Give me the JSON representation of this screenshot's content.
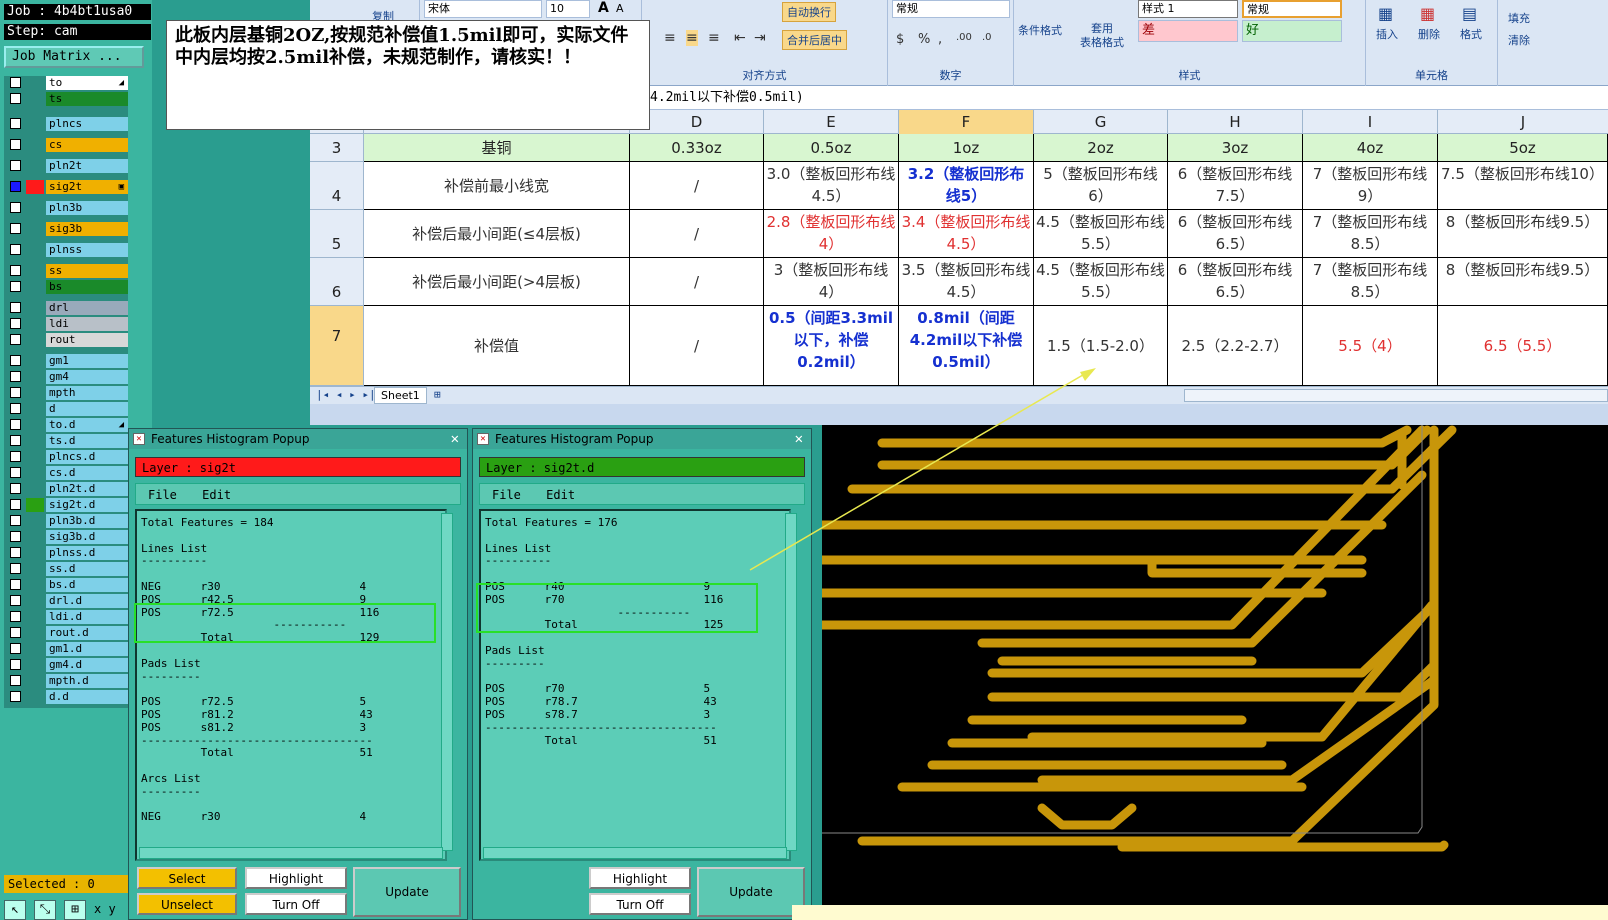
{
  "genesis": {
    "job_label": "Job : 4b4bt1usa0",
    "step_label": "Step: cam",
    "matrix_button": "Job Matrix ...",
    "selected_label": "Selected : 0",
    "layers": [
      {
        "name": "to",
        "color": "#ffffff",
        "mark": "◢"
      },
      {
        "name": "ts",
        "color": "#1a8a2a",
        "mark": ""
      },
      {
        "name": "plncs",
        "color": "#7ed0e8",
        "mark": ""
      },
      {
        "name": "cs",
        "color": "#f0b000",
        "mark": ""
      },
      {
        "name": "pln2t",
        "color": "#7ed0e8",
        "mark": ""
      },
      {
        "name": "sig2t",
        "color": "#f0b000",
        "mark": "▣",
        "active": true
      },
      {
        "name": "pln3b",
        "color": "#7ed0e8",
        "mark": ""
      },
      {
        "name": "sig3b",
        "color": "#f0b000",
        "mark": ""
      },
      {
        "name": "plnss",
        "color": "#7ed0e8",
        "mark": ""
      },
      {
        "name": "ss",
        "color": "#f0b000",
        "mark": ""
      },
      {
        "name": "bs",
        "color": "#1a8a2a",
        "mark": ""
      },
      {
        "name": "drl",
        "color": "#9ab",
        "mark": ""
      },
      {
        "name": "ldi",
        "color": "#b8c0c8",
        "mark": ""
      },
      {
        "name": "rout",
        "color": "#d8d8d8",
        "mark": ""
      },
      {
        "name": "gm1",
        "color": "#7ed0e8",
        "mark": ""
      },
      {
        "name": "gm4",
        "color": "#7ed0e8",
        "mark": ""
      },
      {
        "name": "mpth",
        "color": "#7ed0e8",
        "mark": ""
      },
      {
        "name": "d",
        "color": "#7ed0e8",
        "mark": ""
      },
      {
        "name": "to.d",
        "color": "#7ed0e8",
        "mark": "◢"
      },
      {
        "name": "ts.d",
        "color": "#7ed0e8",
        "mark": ""
      },
      {
        "name": "plncs.d",
        "color": "#7ed0e8",
        "mark": ""
      },
      {
        "name": "cs.d",
        "color": "#7ed0e8",
        "mark": ""
      },
      {
        "name": "pln2t.d",
        "color": "#7ed0e8",
        "mark": ""
      },
      {
        "name": "sig2t.d",
        "color": "#7ed0e8",
        "mark": "",
        "active2": true
      },
      {
        "name": "pln3b.d",
        "color": "#7ed0e8",
        "mark": ""
      },
      {
        "name": "sig3b.d",
        "color": "#7ed0e8",
        "mark": ""
      },
      {
        "name": "plnss.d",
        "color": "#7ed0e8",
        "mark": ""
      },
      {
        "name": "ss.d",
        "color": "#7ed0e8",
        "mark": ""
      },
      {
        "name": "bs.d",
        "color": "#7ed0e8",
        "mark": ""
      },
      {
        "name": "drl.d",
        "color": "#7ed0e8",
        "mark": ""
      },
      {
        "name": "ldi.d",
        "color": "#7ed0e8",
        "mark": ""
      },
      {
        "name": "rout.d",
        "color": "#7ed0e8",
        "mark": ""
      },
      {
        "name": "gm1.d",
        "color": "#7ed0e8",
        "mark": ""
      },
      {
        "name": "gm4.d",
        "color": "#7ed0e8",
        "mark": ""
      },
      {
        "name": "mpth.d",
        "color": "#7ed0e8",
        "mark": ""
      },
      {
        "name": "d.d",
        "color": "#7ed0e8",
        "mark": ""
      }
    ],
    "tools": [
      "↖",
      "⤡",
      "⊞",
      "x y"
    ]
  },
  "excel": {
    "ribbon": {
      "copy": "复制",
      "font": "宋体",
      "font_size": "10",
      "wrap": "自动换行",
      "merge": "合并后居中",
      "number_format": "常规",
      "cond_format": "条件格式",
      "table_format": "套用\n表格格式",
      "style_normal": "常规",
      "style_1": "样式 1",
      "style_bad": "差",
      "style_good": "好",
      "insert": "插入",
      "delete": "删除",
      "format": "格式",
      "fill": "填充",
      "clear": "清除",
      "grp_align": "对齐方式",
      "grp_number": "数字",
      "grp_style": "样式",
      "grp_cells": "单元格"
    },
    "formula": "4.2mil以下补偿0.5mil)",
    "columns": [
      "D",
      "E",
      "F",
      "G",
      "H",
      "I",
      "J"
    ],
    "rows": [
      "3",
      "4",
      "5",
      "6",
      "7"
    ],
    "sheet_tab": "Sheet1",
    "table": {
      "header": [
        "基铜",
        "0.33oz",
        "0.5oz",
        "1oz",
        "2oz",
        "3oz",
        "4oz",
        "5oz"
      ],
      "r4": [
        "补偿前最小线宽",
        "/",
        "3.0（整板回形布线4.5）",
        "3.2（整板回形布线5）",
        "5（整板回形布线6）",
        "6（整板回形布线7.5）",
        "7（整板回形布线9）",
        "7.5（整板回形布线10）"
      ],
      "r5": [
        "补偿后最小间距(≤4层板)",
        "/",
        "2.8（整板回形布线4）",
        "3.4（整板回形布线4.5）",
        "4.5（整板回形布线5.5）",
        "6（整板回形布线6.5）",
        "7（整板回形布线8.5）",
        "8（整板回形布线9.5）"
      ],
      "r6": [
        "补偿后最小间距(>4层板)",
        "/",
        "3（整板回形布线4）",
        "3.5（整板回形布线4.5）",
        "4.5（整板回形布线5.5）",
        "6（整板回形布线6.5）",
        "7（整板回形布线8.5）",
        "8（整板回形布线9.5）"
      ],
      "r7": [
        "补偿值",
        "/",
        "0.5（间距3.3mil以下，补偿0.2mil）",
        "0.8mil（间距4.2mil以下补偿0.5mil）",
        "1.5（1.5-2.0）",
        "2.5（2.2-2.7）",
        "5.5（4）",
        "6.5（5.5）"
      ]
    }
  },
  "note": "此板内层基铜2OZ,按规范补偿值1.5mil即可，实际文件中内层均按2.5mil补偿，未规范制作，请核实！！",
  "popup_left": {
    "title": "Features Histogram Popup",
    "layer": "Layer :  sig2t",
    "layer_color": "#ff1a1a",
    "menu_file": "File",
    "menu_edit": "Edit",
    "body": "Total Features = 184\n\nLines List\n----------\n\nNEG      r30                     4\nPOS      r42.5                   9\nPOS      r72.5                   116\n                    -----------\n         Total                   129\n\nPads List\n---------\n\nPOS      r72.5                   5\nPOS      r81.2                   43\nPOS      s81.2                   3\n-----------------------------------\n         Total                   51\n\nArcs List\n---------\n\nNEG      r30                     4",
    "btn_select": "Select",
    "btn_unselect": "Unselect",
    "btn_highlight": "Highlight",
    "btn_turnoff": "Turn Off",
    "btn_update": "Update"
  },
  "popup_right": {
    "title": "Features Histogram Popup",
    "layer": "Layer :  sig2t.d",
    "layer_color": "#2aa012",
    "menu_file": "File",
    "menu_edit": "Edit",
    "body": "Total Features = 176\n\nLines List\n----------\n\nPOS      r40                     9\nPOS      r70                     116\n                    -----------\n         Total                   125\n\nPads List\n---------\n\nPOS      r70                     5\nPOS      r78.7                   43\nPOS      s78.7                   3\n-----------------------------------\n         Total                   51",
    "btn_highlight": "Highlight",
    "btn_turnoff": "Turn Off",
    "btn_update": "Update"
  },
  "colors": {
    "trace": "#c8960a",
    "arrow": "#e8e850",
    "highlight_box": "#28e028"
  }
}
